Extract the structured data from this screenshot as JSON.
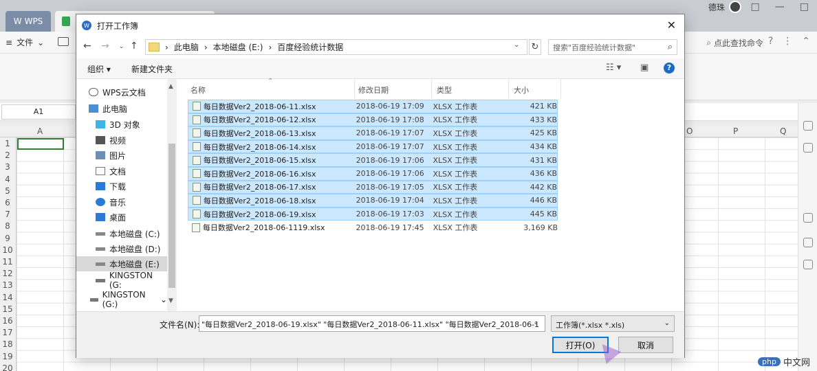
{
  "app": {
    "brand_tab": "WPS",
    "user_name": "德珠",
    "win_controls": [
      "□",
      "—",
      "□",
      "✕"
    ],
    "menu_file": "文件",
    "cmd_search": "点此查找命令",
    "cell_ref": "A1",
    "columns": [
      "A",
      "O",
      "P",
      "Q"
    ],
    "rows": [
      "1",
      "2",
      "3",
      "4",
      "5",
      "6",
      "7",
      "8",
      "9",
      "10",
      "11",
      "12",
      "13",
      "14",
      "15",
      "16",
      "17",
      "18",
      "19",
      "20"
    ]
  },
  "dialog": {
    "title": "打开工作簿",
    "breadcrumb": [
      "此电脑",
      "本地磁盘 (E:)",
      "百度经验统计数据"
    ],
    "search_placeholder": "搜索\"百度经验统计数据\"",
    "toolbar": {
      "organize": "组织 ▾",
      "new_folder": "新建文件夹"
    },
    "nav": [
      {
        "label": "WPS云文档",
        "icon": "cloud-icon"
      },
      {
        "label": "此电脑",
        "icon": "computer-icon"
      },
      {
        "label": "3D 对象",
        "icon": "cube-icon"
      },
      {
        "label": "视频",
        "icon": "video-icon"
      },
      {
        "label": "图片",
        "icon": "picture-icon"
      },
      {
        "label": "文档",
        "icon": "document-icon"
      },
      {
        "label": "下载",
        "icon": "download-icon"
      },
      {
        "label": "音乐",
        "icon": "music-icon"
      },
      {
        "label": "桌面",
        "icon": "desktop-icon"
      },
      {
        "label": "本地磁盘 (C:)",
        "icon": "drive-icon"
      },
      {
        "label": "本地磁盘 (D:)",
        "icon": "drive-icon"
      },
      {
        "label": "本地磁盘 (E:)",
        "icon": "drive-icon"
      },
      {
        "label": "KINGSTON (G:",
        "icon": "usb-drive-icon"
      },
      {
        "label": "KINGSTON (G:)",
        "icon": "usb-drive-icon"
      }
    ],
    "columns": {
      "name": "名称",
      "date": "修改日期",
      "type": "类型",
      "size": "大小"
    },
    "files": [
      {
        "name": "每日数据Ver2_2018-06-11.xlsx",
        "date": "2018-06-19 17:09",
        "type": "XLSX 工作表",
        "size": "421 KB",
        "selected": true
      },
      {
        "name": "每日数据Ver2_2018-06-12.xlsx",
        "date": "2018-06-19 17:08",
        "type": "XLSX 工作表",
        "size": "433 KB",
        "selected": true
      },
      {
        "name": "每日数据Ver2_2018-06-13.xlsx",
        "date": "2018-06-19 17:07",
        "type": "XLSX 工作表",
        "size": "425 KB",
        "selected": true
      },
      {
        "name": "每日数据Ver2_2018-06-14.xlsx",
        "date": "2018-06-19 17:07",
        "type": "XLSX 工作表",
        "size": "434 KB",
        "selected": true
      },
      {
        "name": "每日数据Ver2_2018-06-15.xlsx",
        "date": "2018-06-19 17:06",
        "type": "XLSX 工作表",
        "size": "431 KB",
        "selected": true
      },
      {
        "name": "每日数据Ver2_2018-06-16.xlsx",
        "date": "2018-06-19 17:06",
        "type": "XLSX 工作表",
        "size": "436 KB",
        "selected": true
      },
      {
        "name": "每日数据Ver2_2018-06-17.xlsx",
        "date": "2018-06-19 17:05",
        "type": "XLSX 工作表",
        "size": "442 KB",
        "selected": true
      },
      {
        "name": "每日数据Ver2_2018-06-18.xlsx",
        "date": "2018-06-19 17:04",
        "type": "XLSX 工作表",
        "size": "446 KB",
        "selected": true
      },
      {
        "name": "每日数据Ver2_2018-06-19.xlsx",
        "date": "2018-06-19 17:03",
        "type": "XLSX 工作表",
        "size": "445 KB",
        "selected": true
      },
      {
        "name": "每日数据Ver2_2018-06-1119.xlsx",
        "date": "2018-06-19 17:45",
        "type": "XLSX 工作表",
        "size": "3,169 KB",
        "selected": false
      }
    ],
    "filename_label": "文件名(N):",
    "filename_value": "\"每日数据Ver2_2018-06-19.xlsx\" \"每日数据Ver2_2018-06-11.xlsx\" \"每日数据Ver2_2018-06-1",
    "filetype": "工作簿(*.xlsx *.xls)",
    "open_btn": "打开(O)",
    "cancel_btn": "取消"
  },
  "watermark": {
    "badge": "php",
    "text": "中文网"
  },
  "colors": {
    "selection": "#cce8ff",
    "accent": "#0078d7",
    "wps_tab": "#7b8ca6"
  }
}
